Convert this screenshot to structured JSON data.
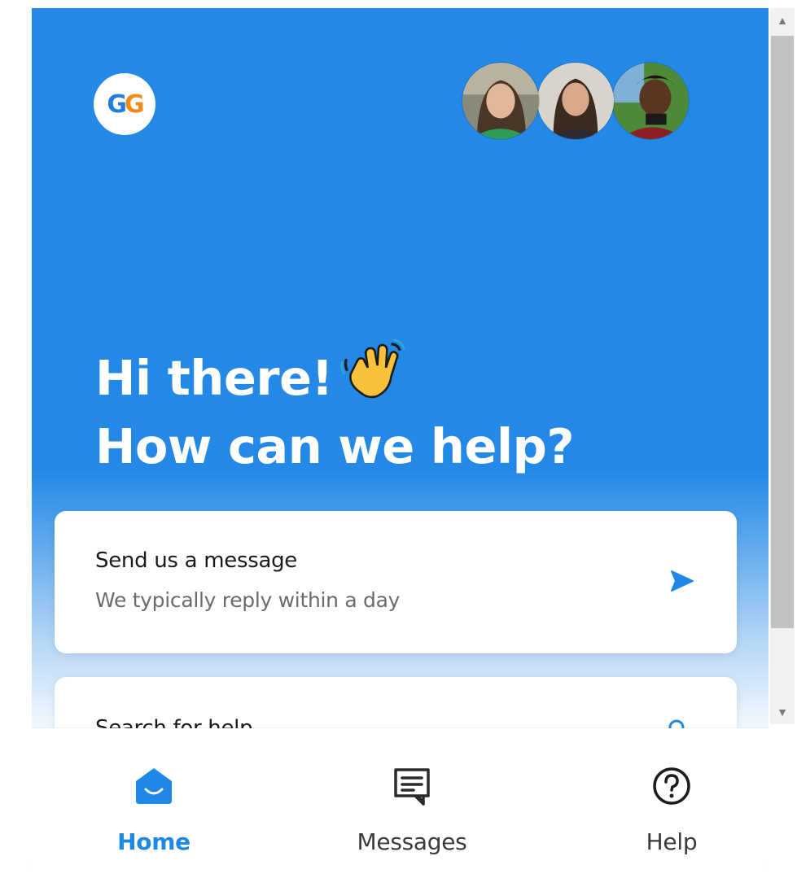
{
  "brand": {
    "logo_left": "G",
    "logo_right": "G",
    "colors": {
      "primary": "#2489e6",
      "logo_blue": "#1f7ee0",
      "logo_orange": "#f28a1a"
    }
  },
  "team": {
    "avatars": [
      {
        "icon": "team-member-avatar"
      },
      {
        "icon": "team-member-avatar"
      },
      {
        "icon": "team-member-avatar"
      }
    ]
  },
  "greeting": {
    "line1": "Hi there!",
    "emoji": "waving-hand",
    "line2": "How can we help?"
  },
  "cards": {
    "message": {
      "title": "Send us a message",
      "subtitle": "We typically reply within a day",
      "icon": "send-arrow-icon"
    },
    "search": {
      "title": "Search for help",
      "icon": "search-icon"
    }
  },
  "nav": {
    "items": [
      {
        "label": "Home",
        "icon": "home-icon",
        "active": true
      },
      {
        "label": "Messages",
        "icon": "messages-icon",
        "active": false
      },
      {
        "label": "Help",
        "icon": "help-icon",
        "active": false
      }
    ]
  }
}
